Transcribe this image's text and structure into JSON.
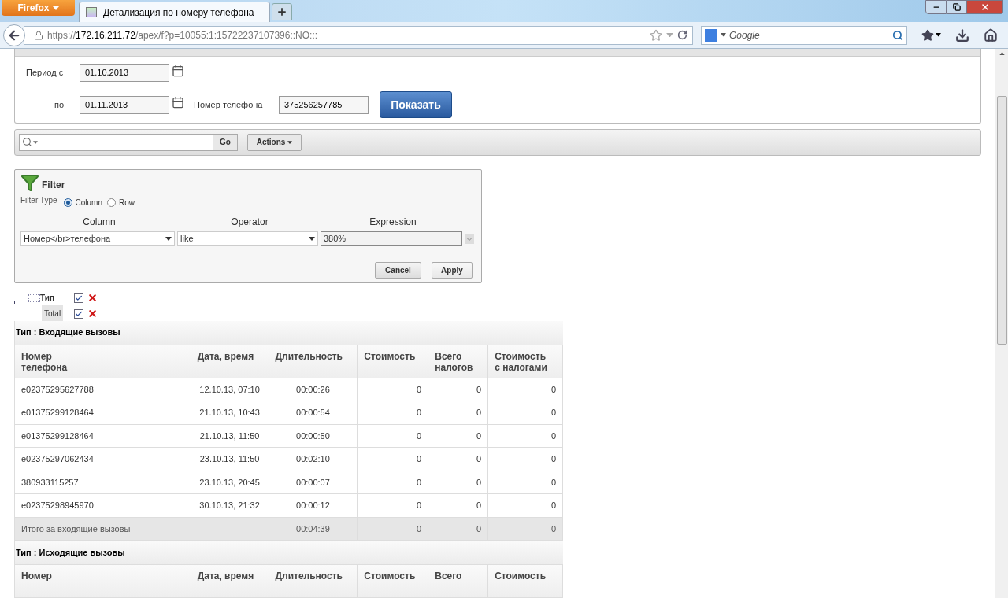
{
  "browser": {
    "menu_button": "Firefox",
    "tab": {
      "title": "Детализация по номеру телефона",
      "selected": true
    },
    "url": {
      "scheme": "https://",
      "host": "172.16.211.72",
      "path": "/apex/f?p=10055:1:15722237107396::NO:::"
    },
    "search": {
      "placeholder": "Google"
    }
  },
  "parameters": {
    "period_from": {
      "label": "Период с",
      "value": "01.10.2013"
    },
    "period_to": {
      "label": "по",
      "value": "01.11.2013"
    },
    "phone": {
      "label": "Номер телефона",
      "value": "375256257785"
    },
    "submit": "Показать"
  },
  "toolbar": {
    "go": "Go",
    "actions": "Actions"
  },
  "filter": {
    "title": "Filter",
    "type_label": "Filter Type",
    "types": [
      {
        "label": "Column",
        "selected": true
      },
      {
        "label": "Row",
        "selected": false
      }
    ],
    "headers": [
      "Column",
      "Operator",
      "Expression"
    ],
    "column": "Номер</br>телефона",
    "operator": "like",
    "expression": "380%",
    "cancel": "Cancel",
    "apply": "Apply"
  },
  "breaks": [
    {
      "label": "Тип",
      "checked": true,
      "kind": "break"
    },
    {
      "label": "Total",
      "checked": true,
      "kind": "total"
    }
  ],
  "groups": [
    {
      "title": "Тип : Входящие вызовы",
      "columns": [
        "Номер\nтелефона",
        "Дата, время",
        "Длительность",
        "Стоимость",
        "Всего\nналогов",
        "Стоимость\nс налогами"
      ],
      "rows": [
        [
          "e02375295627788",
          "12.10.13, 07:10",
          "00:00:26",
          "0",
          "0",
          "0"
        ],
        [
          "e01375299128464",
          "21.10.13, 10:43",
          "00:00:54",
          "0",
          "0",
          "0"
        ],
        [
          "e01375299128464",
          "21.10.13, 11:50",
          "00:00:50",
          "0",
          "0",
          "0"
        ],
        [
          "e02375297062434",
          "23.10.13, 11:50",
          "00:02:10",
          "0",
          "0",
          "0"
        ],
        [
          "380933115257",
          "23.10.13, 20:45",
          "00:00:07",
          "0",
          "0",
          "0"
        ],
        [
          "e02375298945970",
          "30.10.13, 21:32",
          "00:00:12",
          "0",
          "0",
          "0"
        ]
      ],
      "total": [
        "Итого за входящие вызовы",
        "-",
        "00:04:39",
        "0",
        "0",
        "0"
      ]
    },
    {
      "title": "Тип : Исходящие вызовы",
      "columns": [
        "Номер",
        "Дата, время",
        "Длительность",
        "Стоимость",
        "Всего",
        "Стоимость"
      ]
    }
  ]
}
